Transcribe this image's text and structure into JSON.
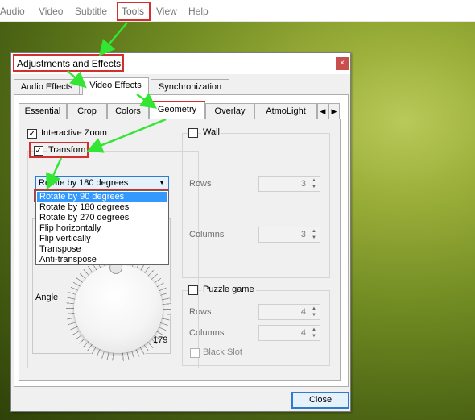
{
  "menubar": {
    "items": [
      "Audio",
      "Video",
      "Subtitle",
      "Tools",
      "View",
      "Help"
    ]
  },
  "dialog": {
    "title": "Adjustments and Effects",
    "close_glyph": "×",
    "tabs": [
      "Audio Effects",
      "Video Effects",
      "Synchronization"
    ],
    "subtabs": [
      "Essential",
      "Crop",
      "Colors",
      "Geometry",
      "Overlay",
      "AtmoLight"
    ],
    "subtab_scroll_left": "◀",
    "subtab_scroll_right": "▶",
    "interactive_zoom": {
      "label": "Interactive Zoom",
      "checked": true
    },
    "transform": {
      "label": "Transform",
      "checked": true,
      "selected": "Rotate by 180 degrees",
      "options": [
        "Rotate by 90 degrees",
        "Rotate by 180 degrees",
        "Rotate by 270 degrees",
        "Flip horizontally",
        "Flip vertically",
        "Transpose",
        "Anti-transpose"
      ],
      "highlighted_index": 0
    },
    "angle": {
      "label": "Angle",
      "value": "179"
    },
    "wall": {
      "label": "Wall",
      "checked": false,
      "rows_label": "Rows",
      "rows_value": "3",
      "columns_label": "Columns",
      "columns_value": "3"
    },
    "puzzle": {
      "label": "Puzzle game",
      "checked": false,
      "rows_label": "Rows",
      "rows_value": "4",
      "columns_label": "Columns",
      "columns_value": "4",
      "black_slot_label": "Black Slot"
    },
    "close_button": "Close"
  },
  "colors": {
    "annotation_red": "#d32f2f",
    "annotation_arrow": "#33e633",
    "selection_blue": "#3399ff"
  }
}
